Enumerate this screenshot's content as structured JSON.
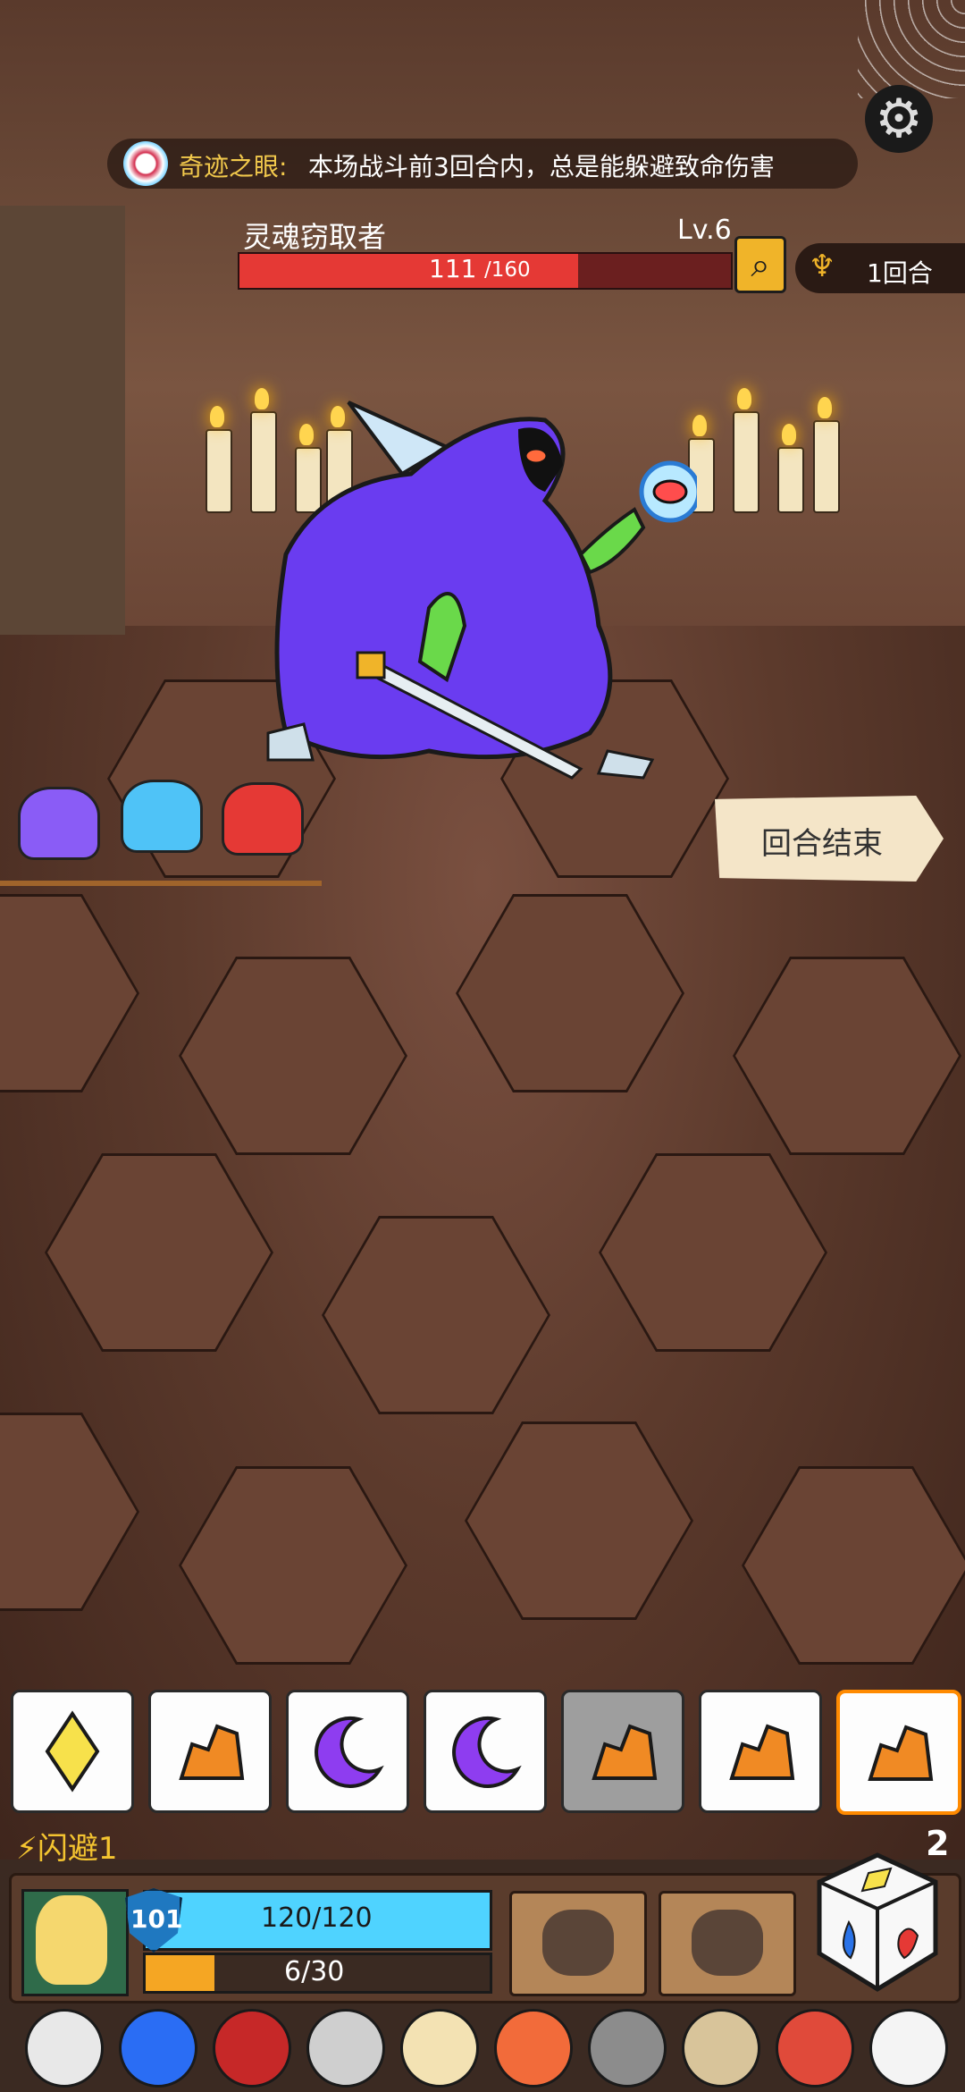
{
  "status_banner": {
    "icon": "miracle-eye-icon",
    "title": "奇迹之眼:",
    "text": "本场战斗前3回合内，总是能躲避致命伤害"
  },
  "settings": {
    "icon": "gear-icon"
  },
  "enemy": {
    "name": "灵魂窃取者",
    "level": "Lv.6",
    "hp_current": "111",
    "hp_max": "/160",
    "hp_fraction": 0.694,
    "inspect_icon": "magnifier-icon"
  },
  "round": {
    "icon": "scroll-icon",
    "label": "1回合"
  },
  "potions": [
    {
      "icon": "purple-eye-potion-icon",
      "color": "#8a5cf6"
    },
    {
      "icon": "blue-potion-icon",
      "color": "#4fc3f7"
    },
    {
      "icon": "red-potion-icon",
      "color": "#e53935"
    }
  ],
  "end_turn": {
    "label": "回合结束"
  },
  "dice": [
    {
      "face": "diamond",
      "color": "#f7e14b",
      "state": "normal"
    },
    {
      "face": "rock",
      "color": "#f08a24",
      "state": "normal"
    },
    {
      "face": "moon",
      "color": "#8e3df0",
      "state": "normal"
    },
    {
      "face": "moon",
      "color": "#8e3df0",
      "state": "normal"
    },
    {
      "face": "rock",
      "color": "#f08a24",
      "state": "disabled"
    },
    {
      "face": "rock",
      "color": "#f08a24",
      "state": "normal"
    },
    {
      "face": "rock",
      "color": "#f08a24",
      "state": "selected"
    }
  ],
  "buffs": {
    "dodge_label": "⚡闪避1",
    "reroll_count": "2"
  },
  "player": {
    "shield": "101",
    "hp": "120/120",
    "hp_fraction": 1.0,
    "energy": "6/30",
    "energy_fraction": 0.2
  },
  "skills": [
    {
      "icon": "spiked-gauntlet-icon"
    },
    {
      "icon": "feather-quill-icon"
    }
  ],
  "items": [
    {
      "icon": "horned-skull-icon",
      "color": "#e8e8e8"
    },
    {
      "icon": "blue-flame-eye-icon",
      "color": "#2a6df4"
    },
    {
      "icon": "ruby-drum-icon",
      "color": "#c62828"
    },
    {
      "icon": "silver-ring-icon",
      "color": "#cfcfcf"
    },
    {
      "icon": "golden-mirror-icon",
      "color": "#f3e2b3"
    },
    {
      "icon": "orange-shield-icon",
      "color": "#f26b3a"
    },
    {
      "icon": "iron-armor-icon",
      "color": "#8c8c8c"
    },
    {
      "icon": "bone-scroll-icon",
      "color": "#d8c49a"
    },
    {
      "icon": "spiky-eye-icon",
      "color": "#e04a3a"
    },
    {
      "icon": "skull-card-icon",
      "color": "#f4f4f4"
    }
  ]
}
